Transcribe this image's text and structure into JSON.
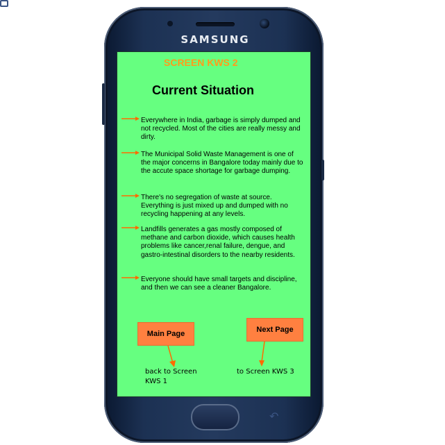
{
  "device": {
    "brand": "SAMSUNG"
  },
  "screen": {
    "title": "SCREEN KWS 2",
    "heading": "Current Situation",
    "bullets": [
      "Everywhere in India, garbage is simply dumped and not recycled. Most of the cities are really messy and dirty.",
      "The Municipal Solid Waste Management is one of the major concerns in Bangalore today mainly due to the accute space shortage for garbage dumping.",
      "There's no segregation of waste at source. Everything is just mixed up and dumped with no recycling happening at any levels.",
      "Landfills generates a gas mostly composed of methane and carbon dioxide, which causes health problems like cancer,renal failure, dengue, and gastro-intestinal disorders to the nearby residents.",
      "Everyone should have small targets and discipline, and then we can see a cleaner Bangalore."
    ],
    "buttons": {
      "main_page": "Main Page",
      "next_page": "Next Page"
    },
    "captions": {
      "back": "back to Screen KWS 1",
      "next": "to Screen KWS 3"
    }
  },
  "colors": {
    "screen_bg": "#66ff80",
    "title": "#ff9c1a",
    "button": "#ff8040",
    "arrow": "#ff6a00"
  },
  "icons": [
    "bullet-arrow-icon",
    "down-arrow-icon",
    "recent-apps-icon",
    "back-icon",
    "home-button"
  ]
}
